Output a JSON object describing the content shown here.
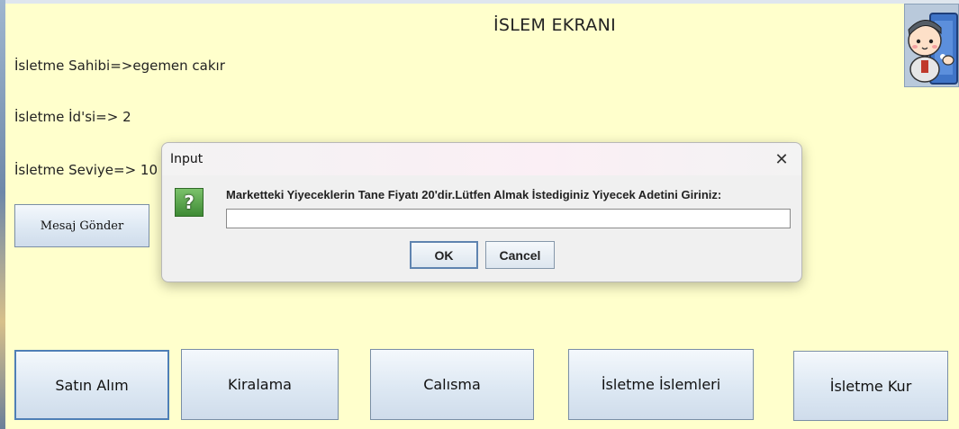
{
  "window": {
    "title": "İSLEM EKRANI"
  },
  "info": {
    "owner": "İsletme Sahibi=>egemen cakır",
    "id": "İsletme İd'si=> 2",
    "level": "İsletme Seviye=> 10"
  },
  "buttons": {
    "send_message": "Mesaj Gönder",
    "purchase": "Satın Alım",
    "rental": "Kiralama",
    "work": "Calısma",
    "business_ops": "İsletme İslemleri",
    "establish": "İsletme Kur"
  },
  "avatar": {
    "icon": "cartoon-person-icon"
  },
  "dialog": {
    "title": "Input",
    "message": "Marketteki Yiyeceklerin Tane Fiyatı 20'dir.Lütfen Almak İstediginiz Yiyecek Adetini Giriniz:",
    "input_value": "",
    "icon": "question-icon",
    "icon_glyph": "?",
    "close_glyph": "✕",
    "ok_label": "OK",
    "cancel_label": "Cancel"
  },
  "colors": {
    "background": "#ffffcc",
    "button_border": "#7a8ea6",
    "dialog_bg": "#f0f0f0",
    "icon_green": "#3e8a34"
  }
}
